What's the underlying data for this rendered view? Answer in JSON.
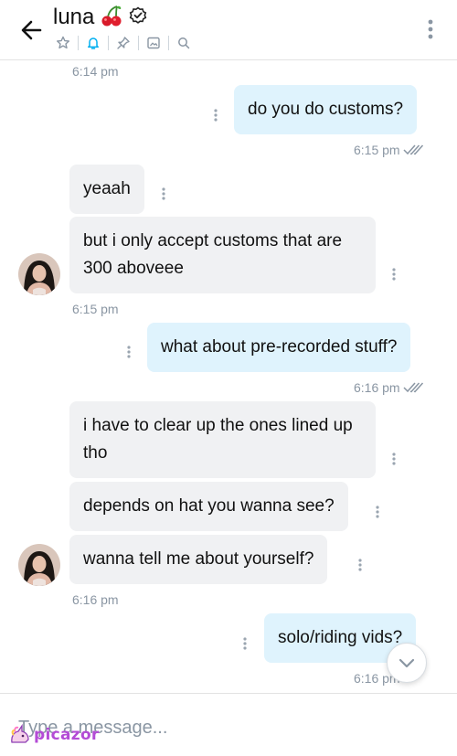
{
  "header": {
    "title": "luna",
    "emoji": "🍒",
    "icons": [
      "back-arrow-icon",
      "verified-badge-icon",
      "star-icon",
      "bell-icon",
      "pin-icon",
      "image-icon",
      "search-icon",
      "more-vertical-icon"
    ],
    "accent": "#00aff0"
  },
  "messages": {
    "ts0": "6:14 pm",
    "m1": "do you do customs?",
    "ts1": "6:15 pm",
    "m2": "yeaah",
    "m3": "but i only accept customs that are 300 aboveee",
    "ts2": "6:15 pm",
    "m4": "what about pre-recorded stuff?",
    "ts3": "6:16 pm",
    "m5": "i have to clear up the ones lined up tho",
    "m6": "depends on hat you wanna see?",
    "m7": "wanna tell me about yourself?",
    "ts4": "6:16 pm",
    "m8": "solo/riding vids?",
    "ts5": "6:16 pm"
  },
  "composer": {
    "placeholder": "Type a message..."
  },
  "watermark": {
    "text": "picazor"
  },
  "colors": {
    "incoming_bubble": "#f0f1f3",
    "outgoing_bubble": "#dff3fd",
    "timestamp": "#8a96a3"
  }
}
